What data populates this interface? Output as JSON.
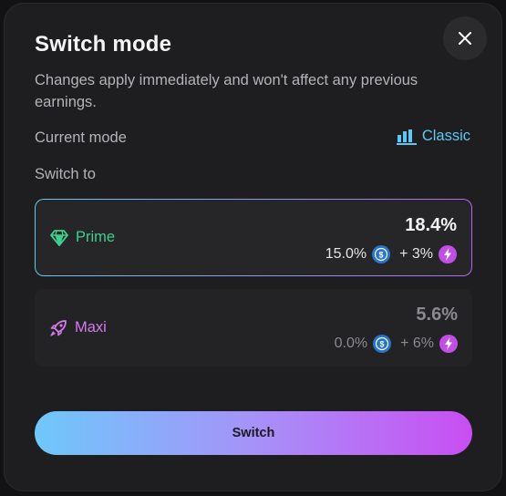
{
  "modal": {
    "title": "Switch mode",
    "subtitle": "Changes apply immediately and won't affect any previous earnings.",
    "close_icon": "close-icon"
  },
  "current_mode": {
    "label": "Current mode",
    "value": "Classic",
    "icon": "bar-chart-icon",
    "color": "#5ec8f5"
  },
  "switch_to": {
    "label": "Switch to",
    "options": [
      {
        "name": "Prime",
        "icon": "gem-icon",
        "total": "18.4%",
        "base": "15.0%",
        "boost": "+ 3%",
        "selected": true,
        "color": "#3ecf8e"
      },
      {
        "name": "Maxi",
        "icon": "rocket-icon",
        "total": "5.6%",
        "base": "0.0%",
        "boost": "+ 6%",
        "selected": false,
        "color": "#d67aee"
      }
    ]
  },
  "actions": {
    "switch_label": "Switch"
  },
  "colors": {
    "background": "#1e1e20",
    "gradient_start": "#6ec8fb",
    "gradient_end": "#c94ef2",
    "usdc": "#2775ca",
    "boost": "#c24ee8"
  }
}
